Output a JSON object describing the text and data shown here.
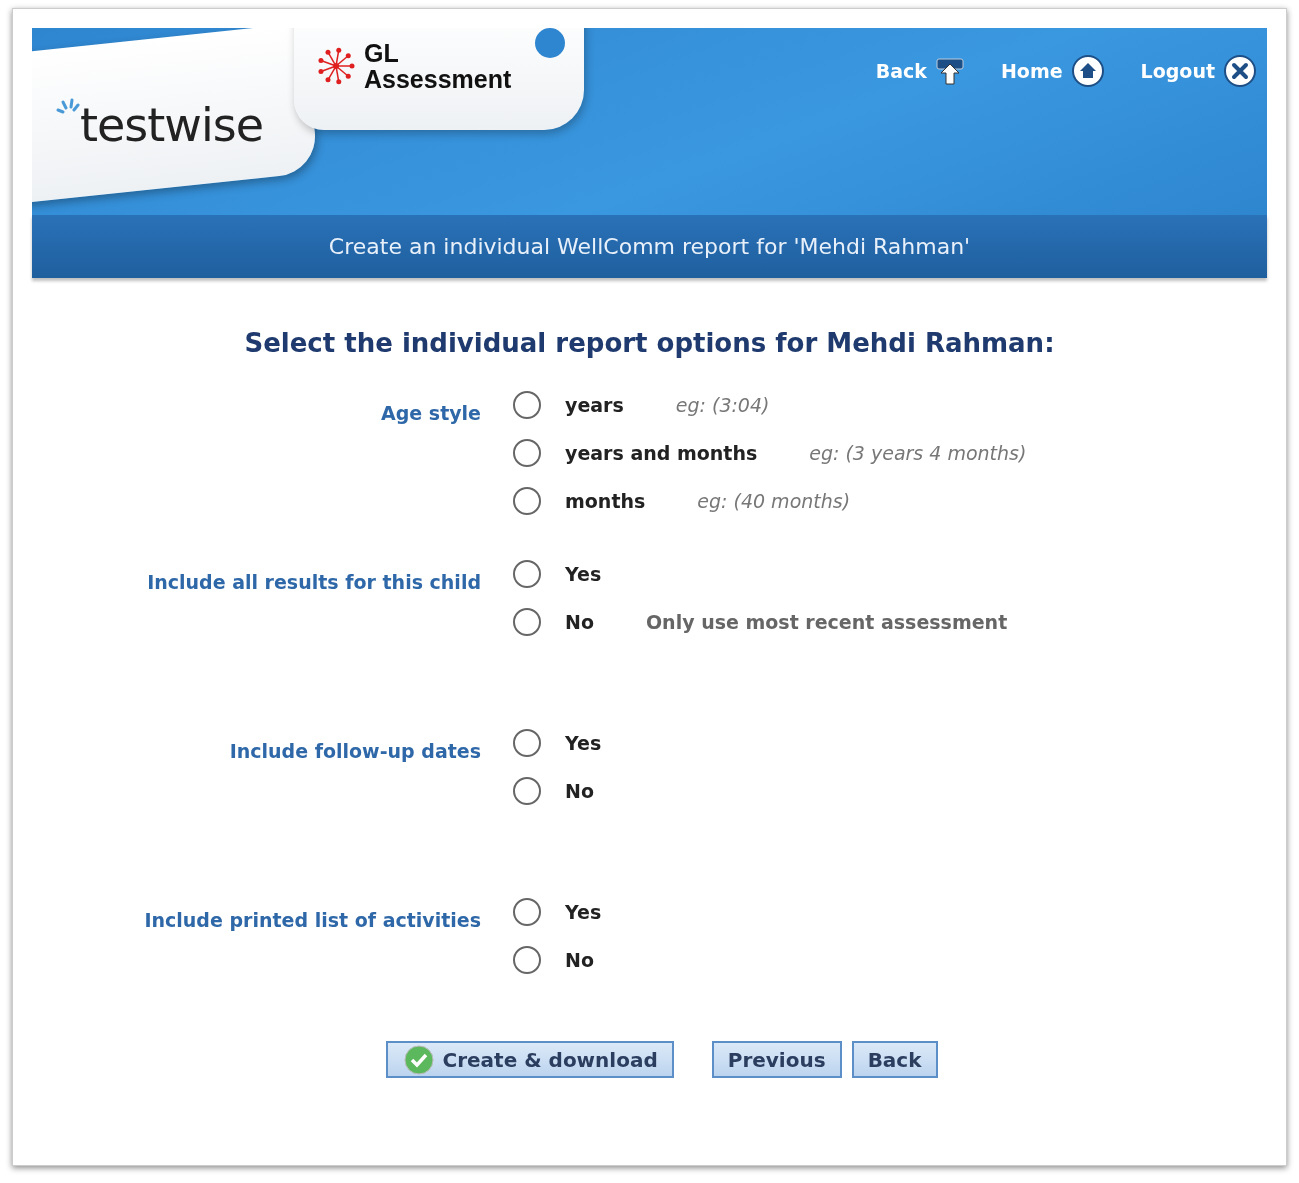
{
  "header": {
    "brand": "testwise",
    "publisher_line_1": "GL",
    "publisher_line_2": "Assessment",
    "nav": [
      {
        "label": "Back",
        "kind": "back"
      },
      {
        "label": "Home",
        "kind": "home"
      },
      {
        "label": "Logout",
        "kind": "logout"
      }
    ]
  },
  "title_bar": "Create an individual WellComm report for 'Mehdi Rahman'",
  "heading": "Select the individual report options for Mehdi Rahman:",
  "groups": [
    {
      "label": "Age style",
      "options": [
        {
          "label": "years",
          "hint": "eg: (3:04)",
          "kind": "example",
          "selected": false
        },
        {
          "label": "years and months",
          "hint": "eg: (3 years 4 months)",
          "kind": "example",
          "selected": false
        },
        {
          "label": "months",
          "hint": "eg: (40 months)",
          "kind": "example",
          "selected": false
        }
      ]
    },
    {
      "label": "Include all results for this child",
      "options": [
        {
          "label": "Yes",
          "selected": false
        },
        {
          "label": "No",
          "hint": "Only use most recent assessment",
          "kind": "note",
          "selected": false
        }
      ]
    },
    {
      "label": "Include follow-up dates",
      "options": [
        {
          "label": "Yes",
          "selected": false
        },
        {
          "label": "No",
          "selected": false
        }
      ]
    },
    {
      "label": "Include printed list of activities",
      "options": [
        {
          "label": "Yes",
          "selected": false
        },
        {
          "label": "No",
          "selected": false
        }
      ]
    }
  ],
  "buttons": [
    {
      "label": "Create & download",
      "kind": "primary"
    },
    {
      "label": "Previous",
      "kind": "plain"
    },
    {
      "label": "Back",
      "kind": "plain"
    }
  ]
}
